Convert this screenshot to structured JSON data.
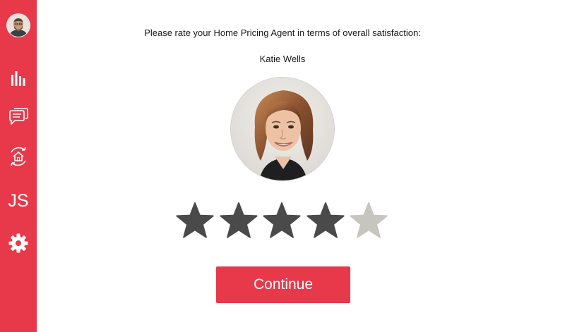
{
  "sidebar": {
    "avatar_icon": "user-avatar",
    "items": [
      {
        "icon": "bar-chart-icon"
      },
      {
        "icon": "chat-bubbles-icon"
      },
      {
        "icon": "home-refresh-icon"
      },
      {
        "label": "JS"
      },
      {
        "icon": "gear-icon"
      }
    ],
    "accent_color": "#e8394a"
  },
  "survey": {
    "prompt": "Please rate your Home Pricing Agent in terms of overall satisfaction:",
    "agent_name": "Katie Wells",
    "rating": 4,
    "max_rating": 5,
    "star_filled_color": "#4a4a4a",
    "star_empty_color": "#c6c6be"
  },
  "actions": {
    "continue_label": "Continue"
  }
}
